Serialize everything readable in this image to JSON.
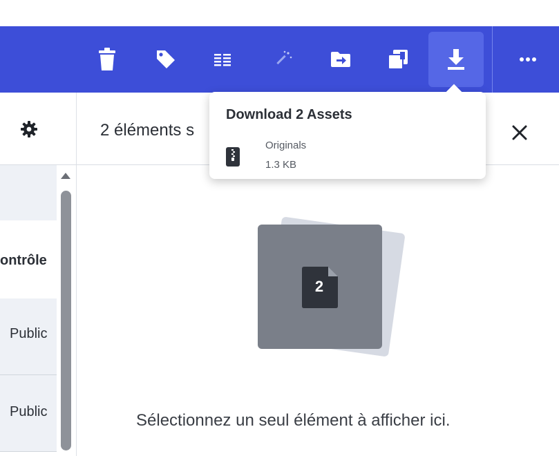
{
  "toolbar": {
    "buttons": [
      {
        "icon": "trash-icon"
      },
      {
        "icon": "tag-icon"
      },
      {
        "icon": "metadata-list-icon"
      },
      {
        "icon": "magic-wand-icon"
      },
      {
        "icon": "move-to-folder-icon"
      },
      {
        "icon": "add-to-collection-icon"
      },
      {
        "icon": "download-icon",
        "active": true
      },
      {
        "icon": "more-icon"
      }
    ],
    "background_color": "#3d4ed8"
  },
  "tooltip": {
    "title": "Download 2 Assets",
    "options": [
      {
        "icon": "zip-file-icon",
        "label": "Originals",
        "size": "1.3 KB"
      }
    ]
  },
  "left_panel": {
    "column_header": "ontrôle",
    "rows": [
      {
        "value": "Public"
      },
      {
        "value": "Public"
      }
    ]
  },
  "right_panel": {
    "selection_count": "2 éléments s",
    "file_count": "2",
    "empty_message": "Sélectionnez un seul élément à afficher ici."
  }
}
